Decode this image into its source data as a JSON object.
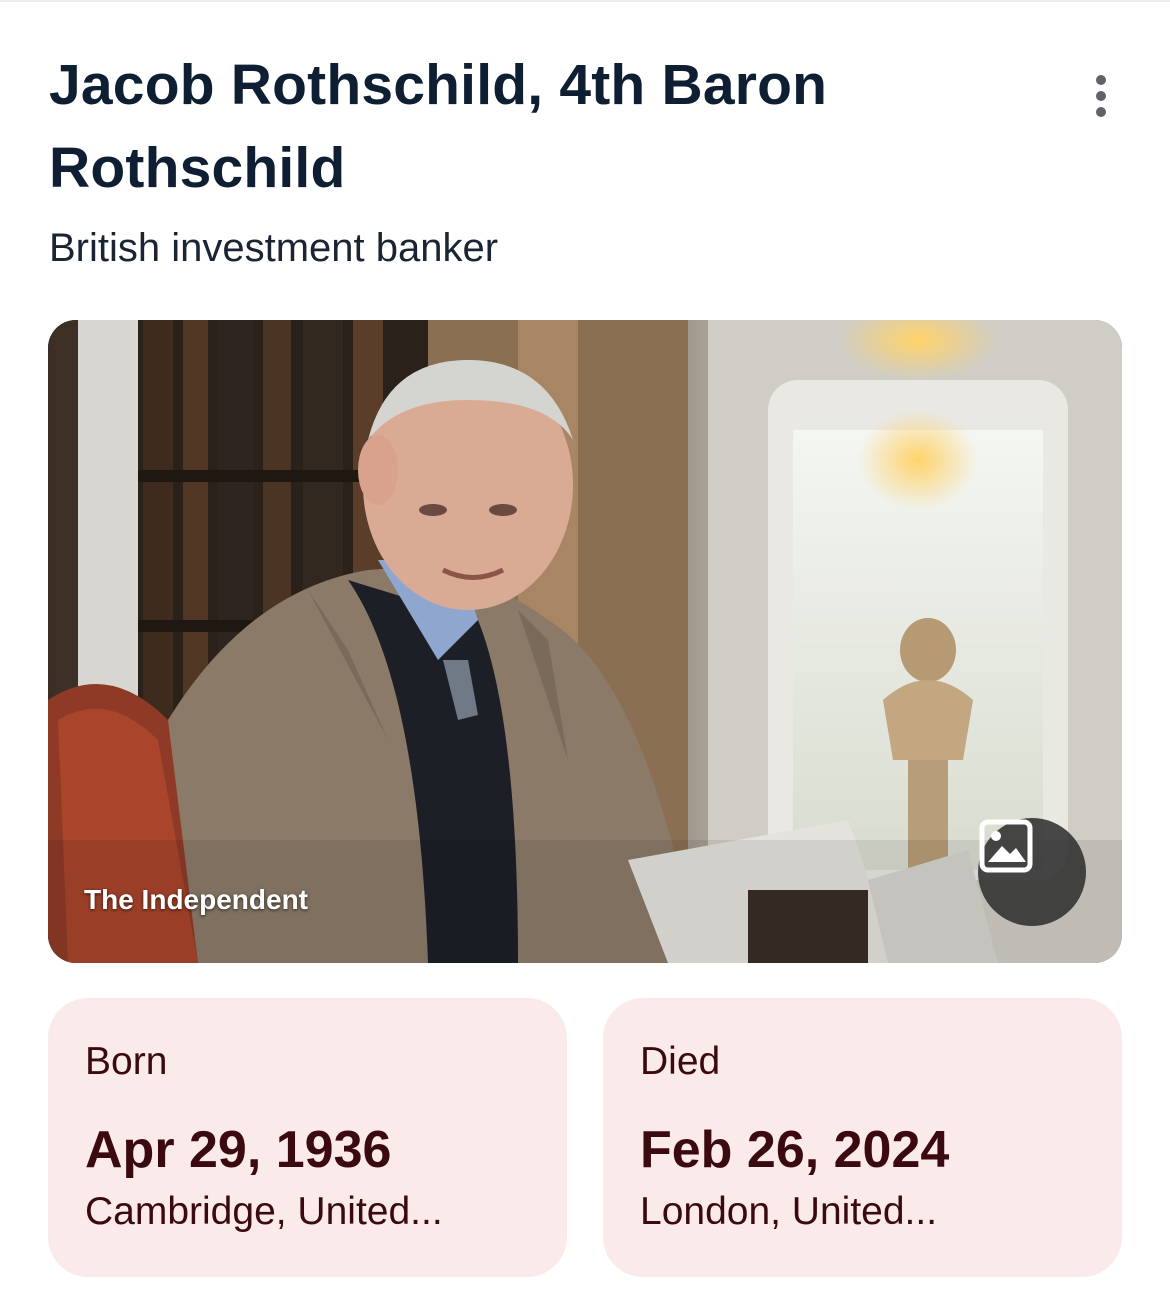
{
  "entity": {
    "title": "Jacob Rothschild, 4th Baron Rothschild",
    "subtitle": "British investment banker"
  },
  "hero_image": {
    "credit": "The Independent",
    "images_button_icon": "image-gallery-icon"
  },
  "menu": {
    "icon": "more-vert-icon"
  },
  "facts": [
    {
      "label": "Born",
      "date": "Apr 29, 1936",
      "place": "Cambridge, United..."
    },
    {
      "label": "Died",
      "date": "Feb 26, 2024",
      "place": "London, United..."
    }
  ],
  "colors": {
    "title_text": "#0f1f33",
    "card_background": "#fbeaea",
    "card_text": "#3b0a10"
  }
}
